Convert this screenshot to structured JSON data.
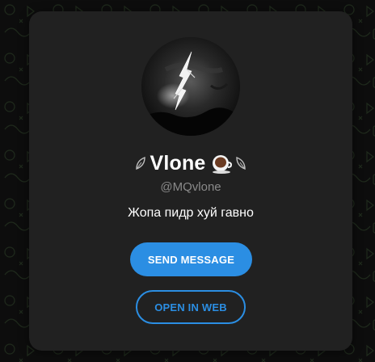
{
  "profile": {
    "name": "Vlone",
    "username": "@MQvlone",
    "bio": "Жопа пидр хуй гавно",
    "avatar_icon": "lightning-photo",
    "title_decorations": [
      "leaf-icon",
      "coffee-cup-icon",
      "leaf-icon"
    ]
  },
  "actions": {
    "send_message_label": "SEND MESSAGE",
    "open_in_web_label": "OPEN IN WEB"
  },
  "colors": {
    "background": "#0d0d0d",
    "card": "#212121",
    "accent": "#2b8ee3",
    "username": "#8a8a8a",
    "text": "#ffffff"
  }
}
